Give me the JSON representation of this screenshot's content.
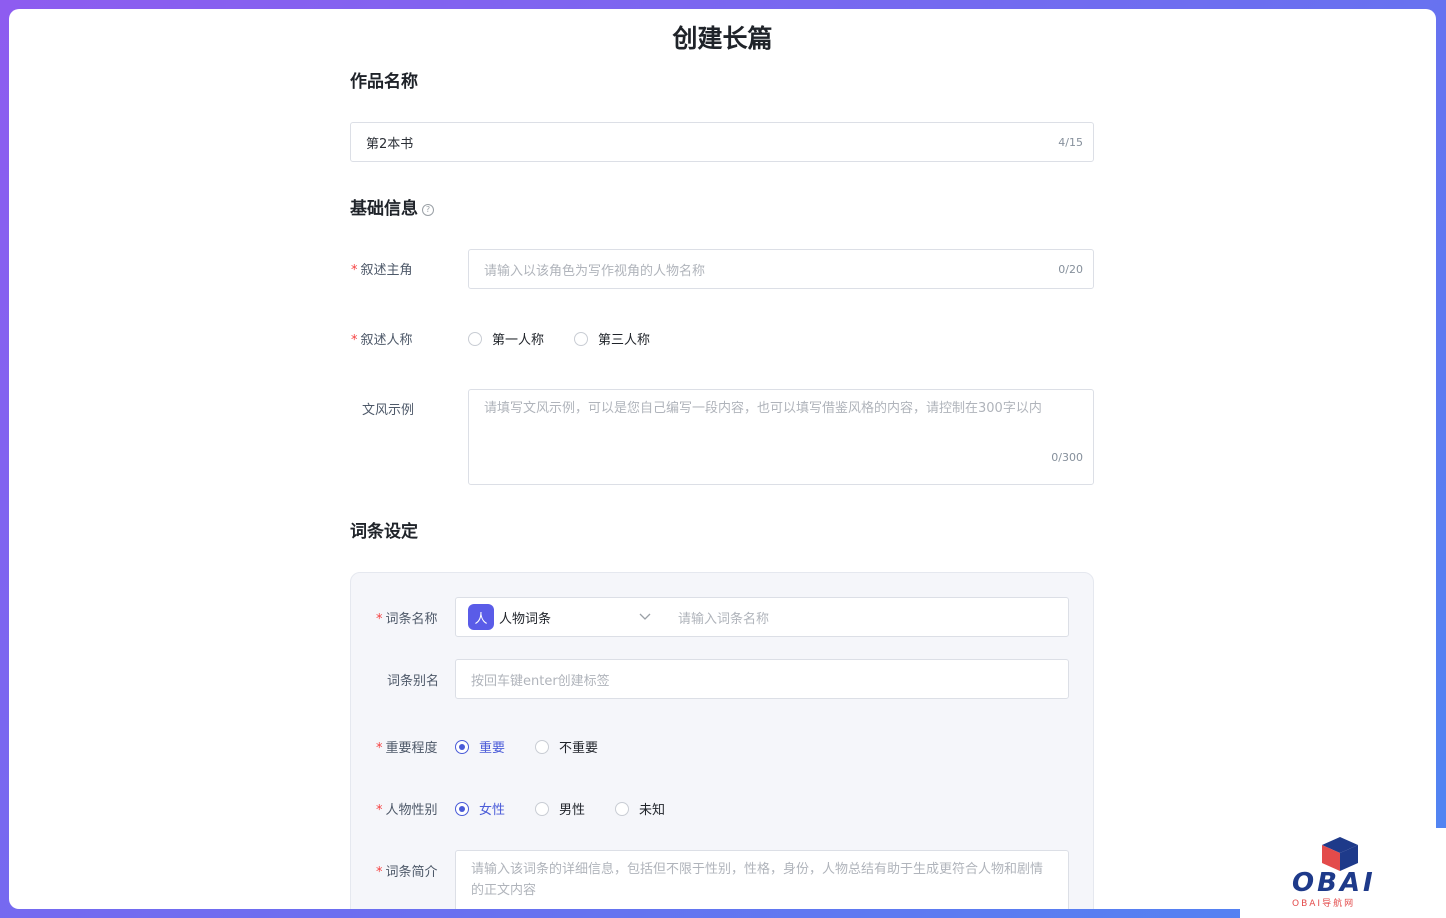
{
  "page_title": "创建长篇",
  "work_name": {
    "section_title": "作品名称",
    "value": "第2本书",
    "counter": "4/15"
  },
  "basic_info": {
    "section_title": "基础信息",
    "help_icon": "?",
    "protagonist": {
      "label": "叙述主角",
      "placeholder": "请输入以该角色为写作视角的人物名称",
      "counter": "0/20"
    },
    "pov": {
      "label": "叙述人称",
      "options": [
        "第一人称",
        "第三人称"
      ]
    },
    "style_sample": {
      "label": "文风示例",
      "placeholder": "请填写文风示例，可以是您自己编写一段内容，也可以填写借鉴风格的内容，请控制在300字以内",
      "counter": "0/300"
    }
  },
  "entry_settings": {
    "section_title": "词条设定",
    "name": {
      "label": "词条名称",
      "type_icon": "人",
      "type_selected": "人物词条",
      "placeholder": "请输入词条名称"
    },
    "alias": {
      "label": "词条别名",
      "placeholder": "按回车键enter创建标签"
    },
    "importance": {
      "label": "重要程度",
      "options": [
        "重要",
        "不重要"
      ],
      "selected": "重要"
    },
    "gender": {
      "label": "人物性别",
      "options": [
        "女性",
        "男性",
        "未知"
      ],
      "selected": "女性"
    },
    "intro": {
      "label": "词条简介",
      "placeholder": "请输入该词条的详细信息，包括但不限于性别，性格，身份，人物总结有助于生成更符合人物和剧情的正文内容"
    }
  },
  "watermark": {
    "logo": "OBAI",
    "sub": "OBAI导航网",
    "colors": {
      "red": "#e34b4b",
      "navy": "#1e3a8a"
    }
  },
  "colors": {
    "accent": "#4a5bd8",
    "required": "#f53f3f",
    "tag": "#5a5ce8"
  }
}
